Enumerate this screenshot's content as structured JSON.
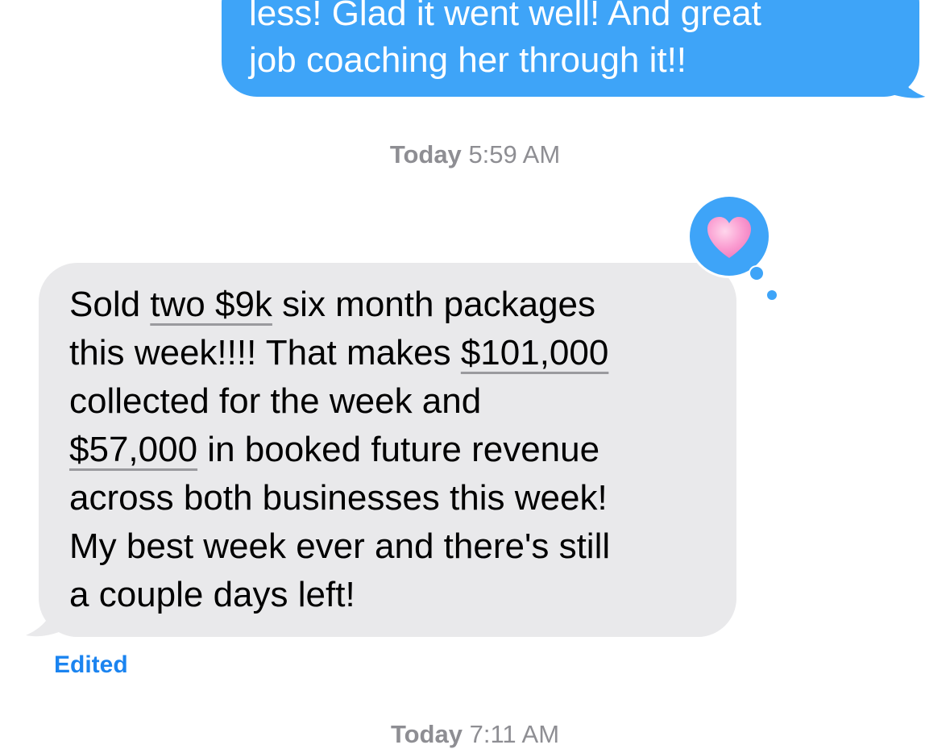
{
  "colors": {
    "sent_bubble": "#3ea4f8",
    "received_bubble": "#e9e9eb",
    "timestamp": "#8e8e93",
    "edited_link": "#1b84f0",
    "heart": "#fa9bd0"
  },
  "sent_message": {
    "lines": [
      "less! Glad it went well! And great",
      "job coaching her through it!!"
    ]
  },
  "timestamp_1": {
    "day": "Today",
    "time": "5:59 AM"
  },
  "tapback": {
    "icon": "heart-icon"
  },
  "received_message": {
    "line1": {
      "a": "Sold ",
      "u": "two $9k",
      "b": " six month packages"
    },
    "line2": {
      "a": "this week!!!! That makes ",
      "u": "$101,000"
    },
    "line3": "collected for the week and",
    "line4": {
      "u": "$57,000",
      "b": " in booked future revenue"
    },
    "line5": "across both businesses this week!",
    "line6": "My best week ever and there's still",
    "line7": "a couple days left!"
  },
  "edited_label": "Edited",
  "timestamp_2": {
    "day": "Today",
    "time": "7:11 AM"
  }
}
